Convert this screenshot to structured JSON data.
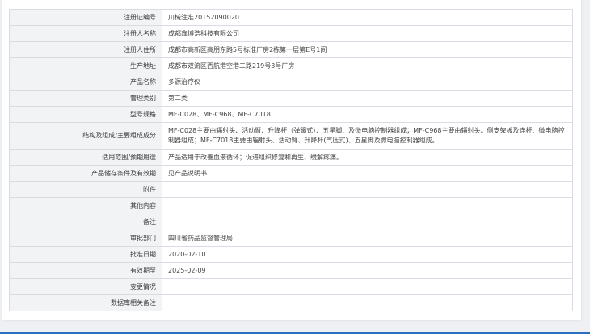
{
  "records": [
    {
      "label": "注册证编号",
      "value": "川械注准20152090020"
    },
    {
      "label": "注册人名称",
      "value": "成都鑫博浩科技有限公司"
    },
    {
      "label": "注册人住所",
      "value": "成都市高新区高朋东路5号标准厂房2栋第一层第E号1间"
    },
    {
      "label": "生产地址",
      "value": "成都市双流区西航港空港二路219号3号厂房"
    },
    {
      "label": "产品名称",
      "value": "多源治疗仪"
    },
    {
      "label": "管理类别",
      "value": "第二类"
    },
    {
      "label": "型号规格",
      "value": "MF-C028、MF-C968、MF-C7018"
    },
    {
      "label": "结构及组成/主要组成成分",
      "value": "MF-C028主要由辐射头、活动臂、升降杆（弹簧式）、五星脚、及微电脑控制器组成；MF-C968主要由辐射头、侧支架板及连杆、微电脑控制器组成；MF-C7018主要由辐射头、活动臂、升降杆(气压式)、五星脚及微电脑控制器组成。"
    },
    {
      "label": "适用范围/预期用途",
      "value": "产品适用于改善血液循环；促进组织修复和再生、缓解疼痛。"
    },
    {
      "label": "产品储存条件及有效期",
      "value": "见产品说明书"
    },
    {
      "label": "附件",
      "value": ""
    },
    {
      "label": "其他内容",
      "value": ""
    },
    {
      "label": "备注",
      "value": ""
    },
    {
      "label": "审批部门",
      "value": "四川省药品监督管理局"
    },
    {
      "label": "批准日期",
      "value": "2020-02-10"
    },
    {
      "label": "有效期至",
      "value": "2025-02-09"
    },
    {
      "label": "变更情况",
      "value": ""
    },
    {
      "label": "数据库相关备注",
      "value": ""
    }
  ],
  "theme": {
    "accent": "#2b6fc2",
    "label_bg": "#f2f3f5",
    "border": "#d9dde3"
  }
}
